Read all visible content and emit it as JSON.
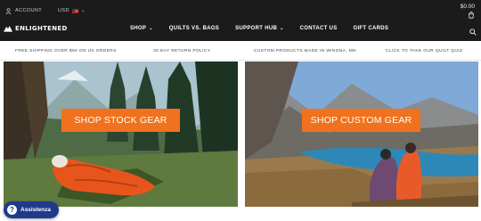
{
  "header": {
    "account_label": "ACCOUNT",
    "currency_label": "USD",
    "cart_total": "$0.00",
    "logo_text": "ENLIGHTENED",
    "nav": [
      {
        "label": "SHOP",
        "has_dropdown": true
      },
      {
        "label": "QUILTS VS. BAGS",
        "has_dropdown": false
      },
      {
        "label": "SUPPORT HUB",
        "has_dropdown": true
      },
      {
        "label": "CONTACT US",
        "has_dropdown": false
      },
      {
        "label": "GIFT CARDS",
        "has_dropdown": false
      }
    ],
    "chevron": "⌄",
    "icons": [
      "person-icon",
      "us-flag-icon",
      "chevron-down-icon",
      "cart-icon",
      "search-icon"
    ]
  },
  "promo_bar": [
    "FREE SHIPPING OVER $50 ON US ORDERS",
    "30 DAY RETURN POLICY",
    "CUSTOM PRODUCTS MADE IN WINONA, MN",
    "CLICK TO TAKE OUR QUILT QUIZ"
  ],
  "hero": {
    "left_button": "SHOP STOCK GEAR",
    "right_button": "SHOP CUSTOM GEAR"
  },
  "chat": {
    "label": "Assistenza",
    "icon_glyph": "?"
  },
  "colors": {
    "header_bg": "#1b1b1b",
    "accent_orange": "#f0721e",
    "chat_blue": "#1f3a8a"
  }
}
